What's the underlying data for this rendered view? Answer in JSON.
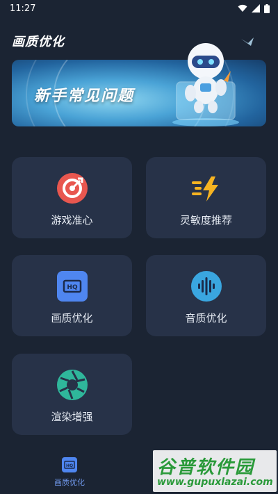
{
  "status_bar": {
    "time": "11:27"
  },
  "app": {
    "title": "画质优化"
  },
  "banner": {
    "text": "新手常见问题"
  },
  "cards": [
    {
      "label": "游戏准心",
      "icon": "crosshair-icon",
      "color": "#e8574f"
    },
    {
      "label": "灵敏度推荐",
      "icon": "lightning-icon",
      "color": "#f6b321"
    },
    {
      "label": "画质优化",
      "icon": "hd-icon",
      "color": "#4f86f0"
    },
    {
      "label": "音质优化",
      "icon": "sound-wave-icon",
      "color": "#3aa6e0"
    },
    {
      "label": "渲染增强",
      "icon": "aperture-icon",
      "color": "#2fb79b"
    }
  ],
  "bottom_nav": {
    "items": [
      {
        "label": "画质优化",
        "icon": "hd-icon"
      }
    ]
  },
  "watermark": {
    "title": "谷普软件园",
    "url": "www.gupuxlazai.com"
  }
}
